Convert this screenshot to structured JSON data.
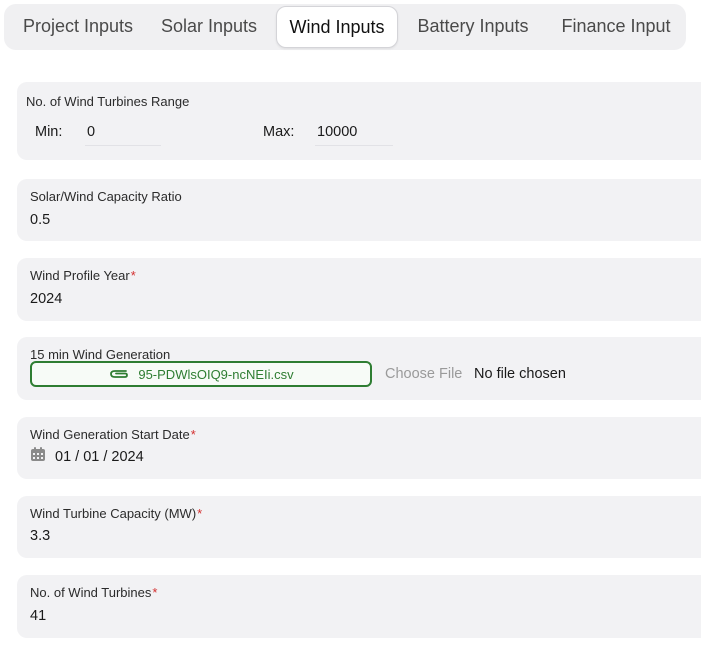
{
  "tabs": [
    {
      "label": "Project Inputs",
      "active": false
    },
    {
      "label": "Solar Inputs",
      "active": false
    },
    {
      "label": "Wind Inputs",
      "active": true
    },
    {
      "label": "Battery Inputs",
      "active": false
    },
    {
      "label": "Finance Input",
      "active": false
    }
  ],
  "turbines_range": {
    "label": "No. of Wind Turbines Range",
    "min_label": "Min:",
    "min_value": "0",
    "max_label": "Max:",
    "max_value": "10000"
  },
  "capacity_ratio": {
    "label": "Solar/Wind Capacity Ratio",
    "value": "0.5"
  },
  "profile_year": {
    "label": "Wind Profile Year",
    "required_mark": "*",
    "value": "2024"
  },
  "wind_generation": {
    "label": "15 min Wind Generation",
    "file_name": "95-PDWlsOIQ9-ncNEIi.csv",
    "file_icon": "paperclip-icon",
    "choose_label": "Choose File",
    "status": "No file chosen"
  },
  "start_date": {
    "label": "Wind Generation Start Date",
    "required_mark": "*",
    "value": "01 / 01 / 2024",
    "icon": "calendar-icon"
  },
  "turbine_capacity": {
    "label": "Wind Turbine Capacity (MW)",
    "required_mark": "*",
    "value": "3.3"
  },
  "num_turbines": {
    "label": "No. of Wind Turbines",
    "required_mark": "*",
    "value": "41"
  },
  "colors": {
    "accent_green": "#2e7d32",
    "required_red": "#d32f2f",
    "card_bg": "#f2f2f4"
  }
}
